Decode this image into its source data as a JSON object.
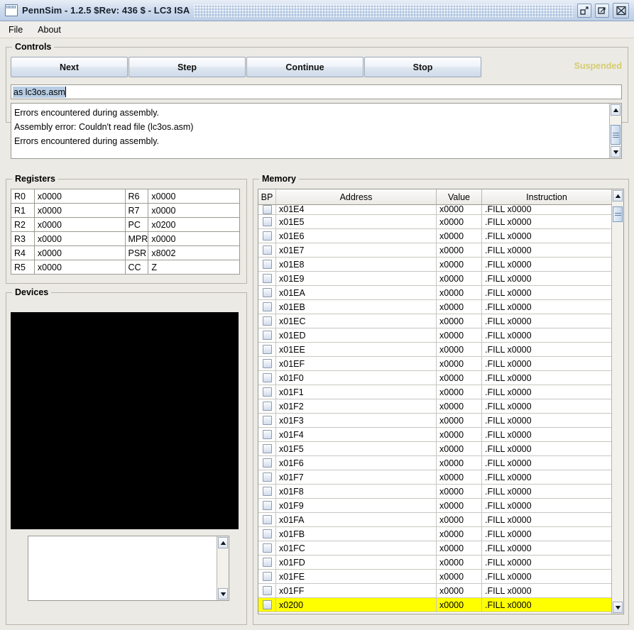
{
  "window": {
    "title": "PennSim - 1.2.5 $Rev: 436 $ - LC3 ISA",
    "icon": "window-icon",
    "buttons": [
      {
        "name": "minimize",
        "label": "↙"
      },
      {
        "name": "maximize",
        "label": "↗"
      },
      {
        "name": "close",
        "label": "✕"
      }
    ]
  },
  "menu": {
    "items": [
      {
        "label": "File"
      },
      {
        "label": "About"
      }
    ]
  },
  "controls": {
    "legend": "Controls",
    "buttons": [
      {
        "label": "Next"
      },
      {
        "label": "Step"
      },
      {
        "label": "Continue"
      },
      {
        "label": "Stop"
      }
    ],
    "status": "Suspended",
    "status_color": "#d6cc72",
    "command_input": {
      "value": "as lc3os.asm",
      "selected": true,
      "placeholder": ""
    },
    "console_lines": [
      "Errors encountered during assembly.",
      "Assembly error: Couldn't read file (lc3os.asm)",
      "Errors encountered during assembly."
    ]
  },
  "registers": {
    "legend": "Registers",
    "rows": [
      {
        "left_name": "R0",
        "left_value": "x0000",
        "right_name": "R6",
        "right_value": "x0000"
      },
      {
        "left_name": "R1",
        "left_value": "x0000",
        "right_name": "R7",
        "right_value": "x0000"
      },
      {
        "left_name": "R2",
        "left_value": "x0000",
        "right_name": "PC",
        "right_value": "x0200"
      },
      {
        "left_name": "R3",
        "left_value": "x0000",
        "right_name": "MPR",
        "right_value": "x0000"
      },
      {
        "left_name": "R4",
        "left_value": "x0000",
        "right_name": "PSR",
        "right_value": "x8002"
      },
      {
        "left_name": "R5",
        "left_value": "x0000",
        "right_name": "CC",
        "right_value": "Z"
      }
    ]
  },
  "devices": {
    "legend": "Devices",
    "display_color": "#000000",
    "input_value": ""
  },
  "memory": {
    "legend": "Memory",
    "columns": [
      "BP",
      "Address",
      "Value",
      "Instruction"
    ],
    "highlight_color": "#ffff00",
    "rows": [
      {
        "address": "x01E4",
        "value": "x0000",
        "instruction": ".FILL x0000",
        "bp": false,
        "highlight": false,
        "clipped": true
      },
      {
        "address": "x01E5",
        "value": "x0000",
        "instruction": ".FILL x0000",
        "bp": false,
        "highlight": false
      },
      {
        "address": "x01E6",
        "value": "x0000",
        "instruction": ".FILL x0000",
        "bp": false,
        "highlight": false
      },
      {
        "address": "x01E7",
        "value": "x0000",
        "instruction": ".FILL x0000",
        "bp": false,
        "highlight": false
      },
      {
        "address": "x01E8",
        "value": "x0000",
        "instruction": ".FILL x0000",
        "bp": false,
        "highlight": false
      },
      {
        "address": "x01E9",
        "value": "x0000",
        "instruction": ".FILL x0000",
        "bp": false,
        "highlight": false
      },
      {
        "address": "x01EA",
        "value": "x0000",
        "instruction": ".FILL x0000",
        "bp": false,
        "highlight": false
      },
      {
        "address": "x01EB",
        "value": "x0000",
        "instruction": ".FILL x0000",
        "bp": false,
        "highlight": false
      },
      {
        "address": "x01EC",
        "value": "x0000",
        "instruction": ".FILL x0000",
        "bp": false,
        "highlight": false
      },
      {
        "address": "x01ED",
        "value": "x0000",
        "instruction": ".FILL x0000",
        "bp": false,
        "highlight": false
      },
      {
        "address": "x01EE",
        "value": "x0000",
        "instruction": ".FILL x0000",
        "bp": false,
        "highlight": false
      },
      {
        "address": "x01EF",
        "value": "x0000",
        "instruction": ".FILL x0000",
        "bp": false,
        "highlight": false
      },
      {
        "address": "x01F0",
        "value": "x0000",
        "instruction": ".FILL x0000",
        "bp": false,
        "highlight": false
      },
      {
        "address": "x01F1",
        "value": "x0000",
        "instruction": ".FILL x0000",
        "bp": false,
        "highlight": false
      },
      {
        "address": "x01F2",
        "value": "x0000",
        "instruction": ".FILL x0000",
        "bp": false,
        "highlight": false
      },
      {
        "address": "x01F3",
        "value": "x0000",
        "instruction": ".FILL x0000",
        "bp": false,
        "highlight": false
      },
      {
        "address": "x01F4",
        "value": "x0000",
        "instruction": ".FILL x0000",
        "bp": false,
        "highlight": false
      },
      {
        "address": "x01F5",
        "value": "x0000",
        "instruction": ".FILL x0000",
        "bp": false,
        "highlight": false
      },
      {
        "address": "x01F6",
        "value": "x0000",
        "instruction": ".FILL x0000",
        "bp": false,
        "highlight": false
      },
      {
        "address": "x01F7",
        "value": "x0000",
        "instruction": ".FILL x0000",
        "bp": false,
        "highlight": false
      },
      {
        "address": "x01F8",
        "value": "x0000",
        "instruction": ".FILL x0000",
        "bp": false,
        "highlight": false
      },
      {
        "address": "x01F9",
        "value": "x0000",
        "instruction": ".FILL x0000",
        "bp": false,
        "highlight": false
      },
      {
        "address": "x01FA",
        "value": "x0000",
        "instruction": ".FILL x0000",
        "bp": false,
        "highlight": false
      },
      {
        "address": "x01FB",
        "value": "x0000",
        "instruction": ".FILL x0000",
        "bp": false,
        "highlight": false
      },
      {
        "address": "x01FC",
        "value": "x0000",
        "instruction": ".FILL x0000",
        "bp": false,
        "highlight": false
      },
      {
        "address": "x01FD",
        "value": "x0000",
        "instruction": ".FILL x0000",
        "bp": false,
        "highlight": false
      },
      {
        "address": "x01FE",
        "value": "x0000",
        "instruction": ".FILL x0000",
        "bp": false,
        "highlight": false
      },
      {
        "address": "x01FF",
        "value": "x0000",
        "instruction": ".FILL x0000",
        "bp": false,
        "highlight": false
      },
      {
        "address": "x0200",
        "value": "x0000",
        "instruction": ".FILL x0000",
        "bp": false,
        "highlight": true
      }
    ]
  }
}
